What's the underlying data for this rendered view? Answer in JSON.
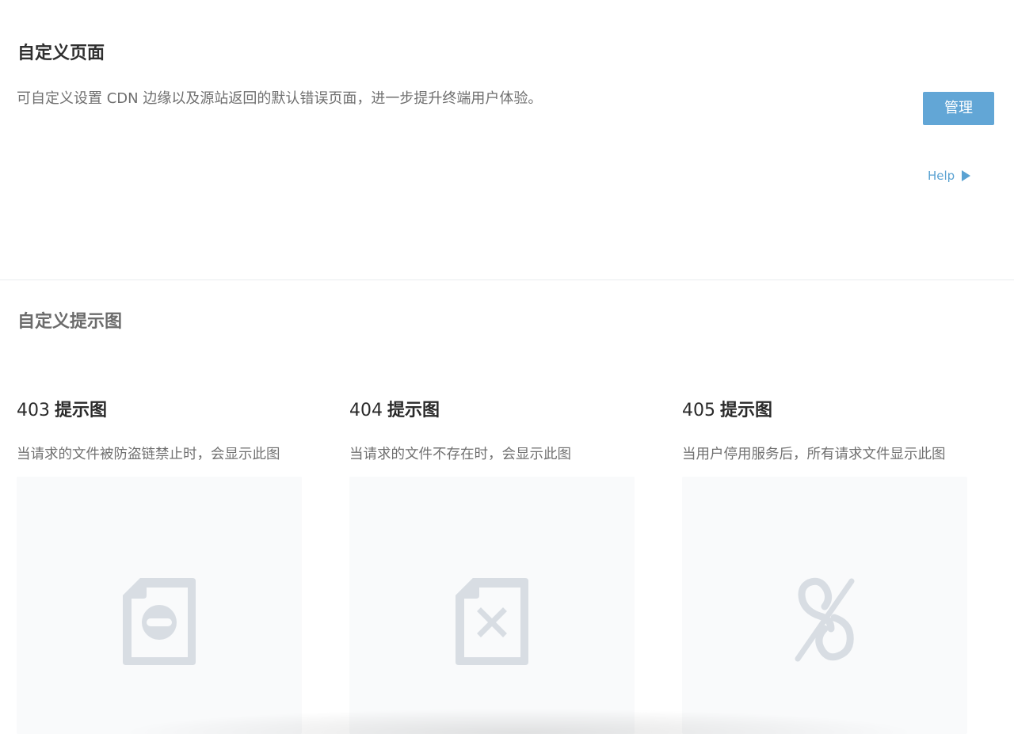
{
  "custom_page": {
    "title": "自定义页面",
    "description": "可自定义设置 CDN 边缘以及源站返回的默认错误页面，进一步提升终端用户体验。",
    "manage_label": "管理",
    "help_label": "Help"
  },
  "custom_image": {
    "title": "自定义提示图",
    "cards": [
      {
        "code": "403",
        "label": "提示图",
        "description": "当请求的文件被防盗链禁止时，会显示此图",
        "icon": "file-forbidden-icon"
      },
      {
        "code": "404",
        "label": "提示图",
        "description": "当请求的文件不存在时，会显示此图",
        "icon": "file-missing-icon"
      },
      {
        "code": "405",
        "label": "提示图",
        "description": "当用户停用服务后，所有请求文件显示此图",
        "icon": "broken-link-icon"
      }
    ]
  },
  "colors": {
    "accent": "#62a6d6",
    "link": "#5aa2d2",
    "icon_gray": "#d8dde3",
    "preview_bg": "#f9fafb"
  }
}
